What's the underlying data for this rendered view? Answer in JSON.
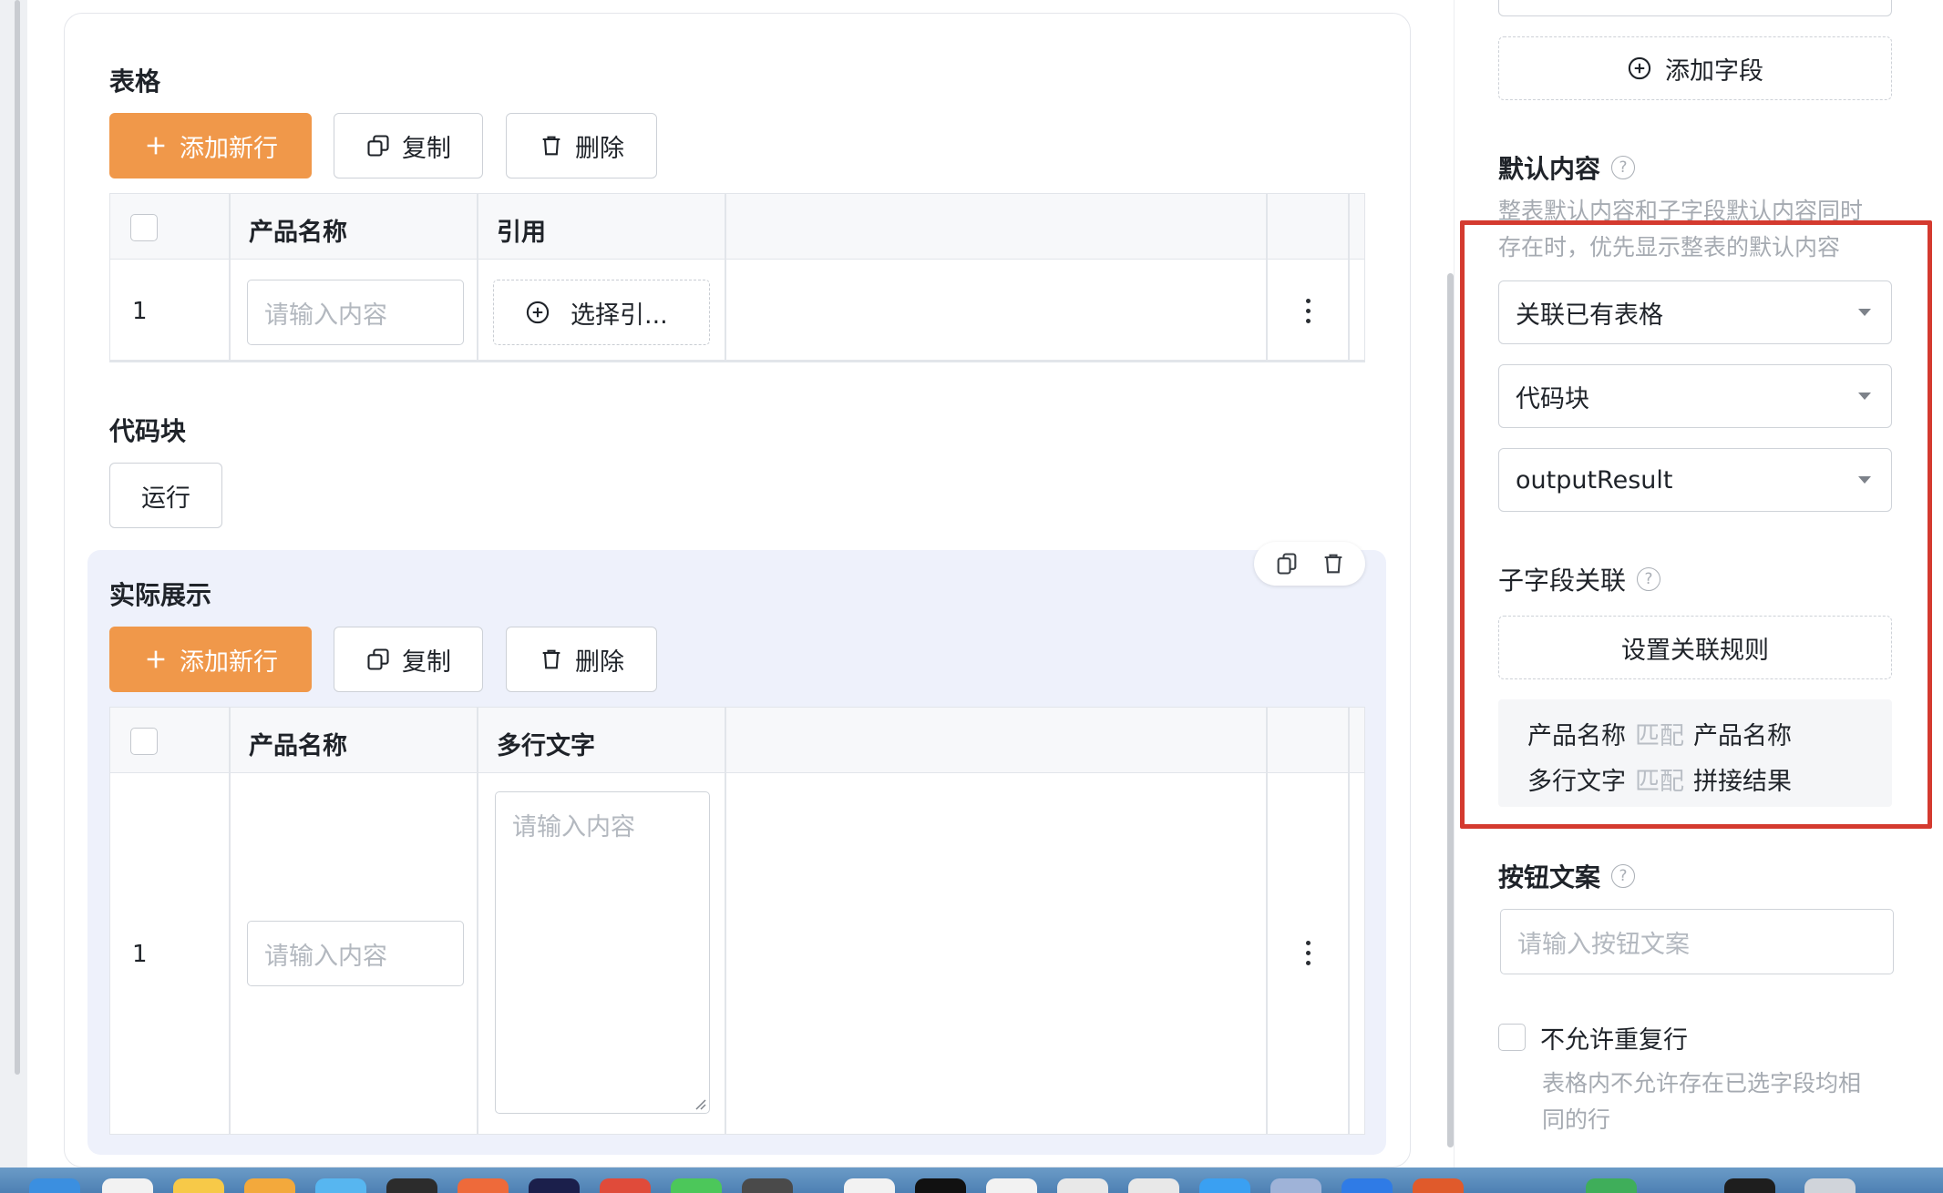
{
  "table_section": {
    "title": "表格",
    "add_row": "添加新行",
    "copy": "复制",
    "delete": "删除",
    "headers": [
      "产品名称",
      "引用"
    ],
    "rows": [
      {
        "num": "1",
        "input_placeholder": "请输入内容",
        "ref_button": "选择引..."
      }
    ]
  },
  "code_section": {
    "title": "代码块",
    "run": "运行"
  },
  "preview_section": {
    "title": "实际展示",
    "add_row": "添加新行",
    "copy": "复制",
    "delete": "删除",
    "headers": [
      "产品名称",
      "多行文字"
    ],
    "rows": [
      {
        "num": "1",
        "input_placeholder": "请输入内容",
        "textarea_placeholder": "请输入内容"
      }
    ]
  },
  "panel": {
    "add_field": "添加字段",
    "default_content": {
      "label": "默认内容",
      "hint_line1": "整表默认内容和子字段默认内容同时",
      "hint_line2": "存在时，优先显示整表的默认内容",
      "select1": "关联已有表格",
      "select2": "代码块",
      "select3": "outputResult"
    },
    "sub_field": {
      "label": "子字段关联",
      "rule_button": "设置关联规则",
      "rules": [
        {
          "left": "产品名称",
          "op": "匹配",
          "right": "产品名称"
        },
        {
          "left": "多行文字",
          "op": "匹配",
          "right": "拼接结果"
        }
      ]
    },
    "button_text": {
      "label": "按钮文案",
      "placeholder": "请输入按钮文案"
    },
    "no_dup": {
      "label": "不允许重复行",
      "hint_line1": "表格内不允许存在已选字段均相",
      "hint_line2": "同的行"
    }
  },
  "icons": [
    "plus-icon",
    "copy-icon",
    "trash-icon",
    "plus-circle-icon",
    "more-vertical-icon",
    "help-icon",
    "caret-down-icon"
  ],
  "colors": {
    "primary": "#f0984a",
    "highlight_border": "#d43a2f",
    "preview_bg": "#eef1fb"
  }
}
